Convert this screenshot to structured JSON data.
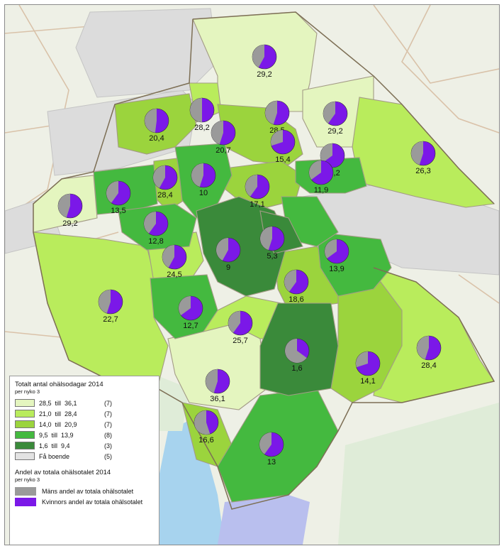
{
  "legend": {
    "title": "Totalt antal ohälsodagar 2014",
    "subtitle": "per nyko 3",
    "classes": [
      {
        "label": "28,5  till  36,1",
        "count": "(7)",
        "color": "#e4f5bf"
      },
      {
        "label": "21,0  till  28,4",
        "count": "(7)",
        "color": "#b9ec5c"
      },
      {
        "label": "14,0  till  20,9",
        "count": "(7)",
        "color": "#9bd43d"
      },
      {
        "label": "9,5  till  13,9",
        "count": "(8)",
        "color": "#44b93f"
      },
      {
        "label": "1,6  till  9,4",
        "count": "(3)",
        "color": "#3a8a3a"
      },
      {
        "label": "Få boende",
        "count": "(5)",
        "color": "#e3e3e3"
      }
    ],
    "pie_title": "Andel av totala ohälsotalet 2014",
    "pie_subtitle": "per nyko 3",
    "pie_items": [
      {
        "label": "Mäns andel av totala ohälsotalet",
        "color": "#9a9a9a"
      },
      {
        "label": "Kvinnors andel av totala ohälsotalet",
        "color": "#7b18e8"
      }
    ]
  },
  "areas": [
    {
      "value": "29,2",
      "men_share": 0.42
    },
    {
      "value": "20,4",
      "men_share": 0.48
    },
    {
      "value": "28,2",
      "men_share": 0.5
    },
    {
      "value": "28,5",
      "men_share": 0.45
    },
    {
      "value": "29,2",
      "men_share": 0.4
    },
    {
      "value": "20,7",
      "men_share": 0.45
    },
    {
      "value": "15,4",
      "men_share": 0.3
    },
    {
      "value": "29,2",
      "men_share": 0.35
    },
    {
      "value": "26,3",
      "men_share": 0.45
    },
    {
      "value": "10",
      "men_share": 0.45
    },
    {
      "value": "28,4",
      "men_share": 0.42
    },
    {
      "value": "11,9",
      "men_share": 0.35
    },
    {
      "value": "13,5",
      "men_share": 0.4
    },
    {
      "value": "17,1",
      "men_share": 0.4
    },
    {
      "value": "29,2",
      "men_share": 0.45
    },
    {
      "value": "12,8",
      "men_share": 0.4
    },
    {
      "value": "5,3",
      "men_share": 0.45
    },
    {
      "value": "9",
      "men_share": 0.42
    },
    {
      "value": "13,9",
      "men_share": 0.35
    },
    {
      "value": "24,5",
      "men_share": 0.42
    },
    {
      "value": "18,6",
      "men_share": 0.4
    },
    {
      "value": "22,7",
      "men_share": 0.45
    },
    {
      "value": "12,7",
      "men_share": 0.35
    },
    {
      "value": "25,7",
      "men_share": 0.4
    },
    {
      "value": "1,6",
      "men_share": 0.65
    },
    {
      "value": "14,1",
      "men_share": 0.3
    },
    {
      "value": "28,4",
      "men_share": 0.45
    },
    {
      "value": "36,1",
      "men_share": 0.45
    },
    {
      "value": "16,6",
      "men_share": 0.55
    },
    {
      "value": "13",
      "men_share": 0.4
    }
  ]
}
